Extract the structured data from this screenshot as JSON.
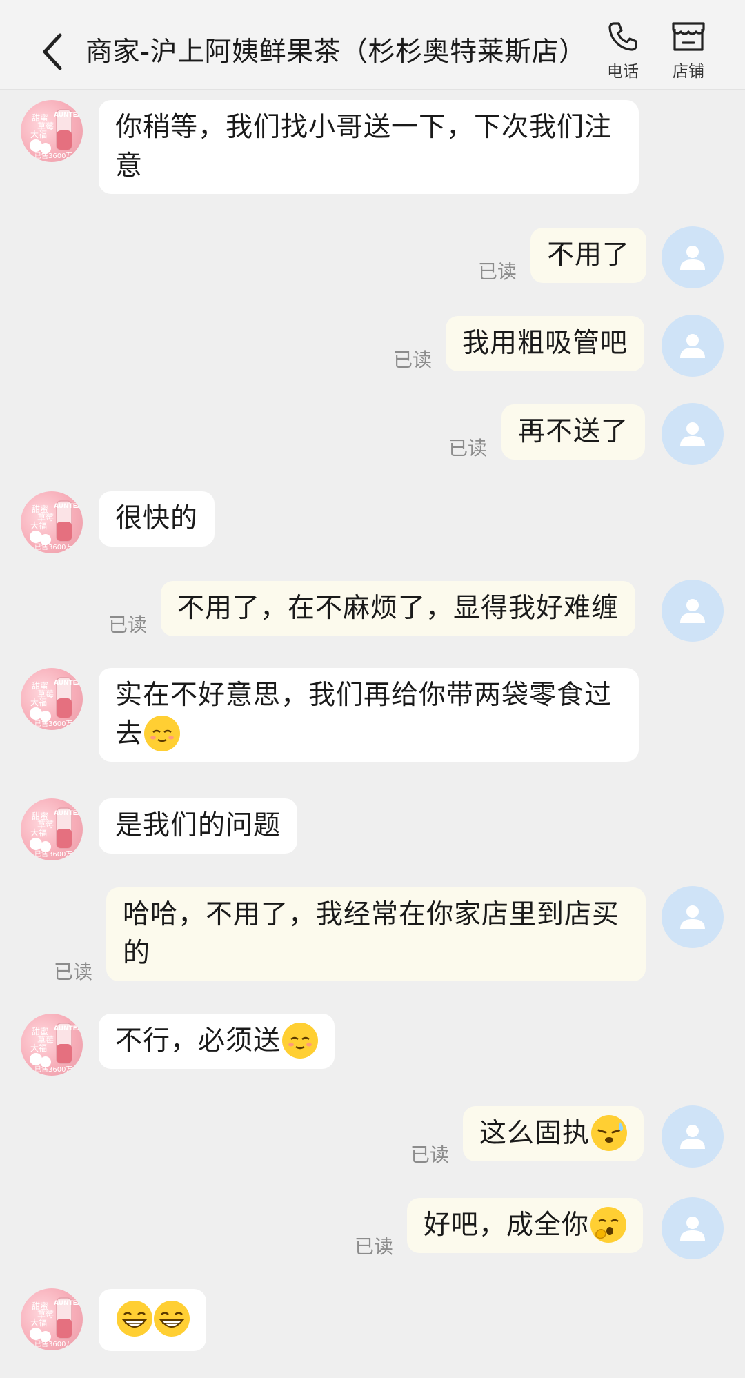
{
  "header": {
    "title": "商家-沪上阿姨鲜果茶（杉杉奥特莱斯店）",
    "phone_label": "电话",
    "store_label": "店铺"
  },
  "read_label": "已读",
  "messages": [
    {
      "side": "in",
      "text": "你稍等，我们找小哥送一下，下次我们注意"
    },
    {
      "side": "out",
      "text": "不用了",
      "status": "已读"
    },
    {
      "side": "out",
      "text": "我用粗吸管吧",
      "status": "已读"
    },
    {
      "side": "out",
      "text": "再不送了",
      "status": "已读"
    },
    {
      "side": "in",
      "text": "很快的"
    },
    {
      "side": "out",
      "text": "不用了，在不麻烦了，显得我好难缠",
      "status": "已读"
    },
    {
      "side": "in",
      "text": "实在不好意思，我们再给你带两袋零食过去",
      "emoji": "shy-smile-emoji"
    },
    {
      "side": "in",
      "text": "是我们的问题"
    },
    {
      "side": "out",
      "text": "哈哈，不用了，我经常在你家店里到店买的",
      "status": "已读"
    },
    {
      "side": "in",
      "text": "不行，必须送",
      "emoji": "shy-smile-emoji"
    },
    {
      "side": "out",
      "text": "这么固执",
      "status": "已读",
      "emoji": "sweat-emoji"
    },
    {
      "side": "out",
      "text": "好吧，成全你",
      "status": "已读",
      "emoji": "yawn-emoji"
    },
    {
      "side": "in",
      "text": "",
      "emoji": "grin-emoji x2"
    }
  ],
  "avatar_shop": {
    "text_lines": [
      "甜蜜",
      "草莓",
      "大福",
      "AUNTEA",
      "已售3600万杯"
    ]
  },
  "colors": {
    "background": "#efefef",
    "incoming_bubble": "#ffffff",
    "outgoing_bubble": "#fcfaed",
    "user_avatar": "#cfe3f7",
    "shop_avatar": "#f7aeb9",
    "read_text": "#8c8c8c"
  }
}
